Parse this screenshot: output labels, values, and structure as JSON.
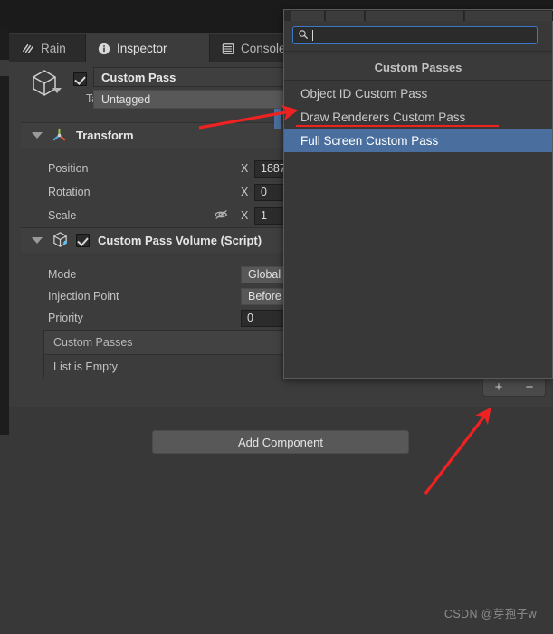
{
  "window": {
    "tabs": [
      {
        "label": "Rain",
        "icon": "rain-icon",
        "active": false
      },
      {
        "label": "Inspector",
        "icon": "info-icon",
        "active": true
      },
      {
        "label": "Console",
        "icon": "console-icon",
        "active": false
      }
    ]
  },
  "inspector": {
    "object": {
      "enabled_checkbox": true,
      "name": "Custom Pass",
      "tag_label": "Tag",
      "tag_value": "Untagged",
      "icon": "cube-icon"
    },
    "transform": {
      "title": "Transform",
      "icon": "transform-axis-icon",
      "rows": [
        {
          "label": "Position",
          "axis": "X",
          "value": "1887"
        },
        {
          "label": "Rotation",
          "axis": "X",
          "value": "0"
        },
        {
          "label": "Scale",
          "axis": "X",
          "value": "1",
          "extra_icon": "link-broken-icon"
        }
      ]
    },
    "custom_pass_volume": {
      "title": "Custom Pass Volume (Script)",
      "icon": "script-cube-icon",
      "enabled_checkbox": true,
      "rows": [
        {
          "label": "Mode",
          "value": "Global",
          "kind": "popup"
        },
        {
          "label": "Injection Point",
          "value": "Before",
          "kind": "popup"
        },
        {
          "label": "Priority",
          "value": "0",
          "kind": "number"
        }
      ],
      "list": {
        "header": "Custom Passes",
        "empty_text": "List is Empty",
        "add_button": "+",
        "remove_button": "−"
      }
    }
  },
  "lower": {
    "add_component_label": "Add Component"
  },
  "popup": {
    "search_placeholder": "",
    "search_value": "",
    "search_icon": "search-icon",
    "title": "Custom Passes",
    "items": [
      {
        "label": "Object ID Custom Pass",
        "selected": false
      },
      {
        "label": "Draw Renderers Custom Pass",
        "selected": false,
        "annotated": true
      },
      {
        "label": "Full Screen Custom Pass",
        "selected": true
      }
    ]
  },
  "watermark": {
    "text": "CSDN @芽孢子w"
  },
  "colors": {
    "panel_bg": "#3c3c3c",
    "window_bg": "#383838",
    "selection_blue": "#4a6f9e",
    "focus_blue": "#3c78c8",
    "annotation_red": "#ef2222",
    "text": "#c6c6c6"
  }
}
